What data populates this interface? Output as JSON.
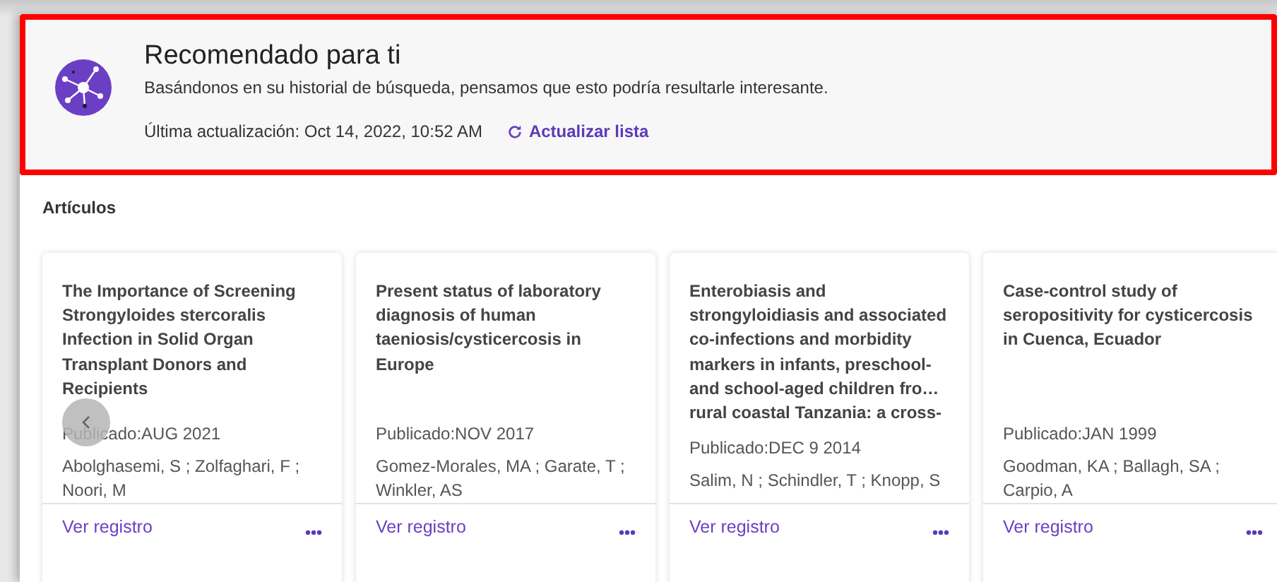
{
  "header": {
    "title": "Recomendado para ti",
    "subtitle": "Basándonos en su historial de búsqueda, pensamos que esto podría resultarle interesante.",
    "updated": "Última actualización: Oct 14, 2022, 10:52 AM",
    "refresh_link": "Actualizar lista",
    "highlighted": true
  },
  "section_title": "Artículos",
  "articles": [
    {
      "title": "The Importance of Screening Strongyloides stercoralis Infection in Solid Organ Transplant Donors and Recipients",
      "published": "Publicado:AUG 2021",
      "authors": "Abolghasemi, S ; Zolfaghari, F ; Noori, M",
      "link": "Ver registro"
    },
    {
      "title": "Present status of laboratory diagnosis of human taeniosis/cysticercosis in Europe",
      "published": "Publicado:NOV 2017",
      "authors": "Gomez-Morales, MA ; Garate, T ; Winkler, AS",
      "link": "Ver registro"
    },
    {
      "title": "Enterobiasis and strongyloidiasis and associated co-infections and morbidity markers in infants, preschool- and school-aged children fro… rural coastal Tanzania: a cross-",
      "published": "Publicado:DEC 9 2014",
      "authors": "Salim, N ; Schindler, T ; Knopp, S",
      "link": "Ver registro"
    },
    {
      "title": "Case-control study of seropositivity for cysticercosis in Cuenca, Ecuador",
      "published": "Publicado:JAN 1999",
      "authors": "Goodman, KA ; Ballagh, SA ; Carpio, A",
      "link": "Ver registro"
    }
  ]
}
